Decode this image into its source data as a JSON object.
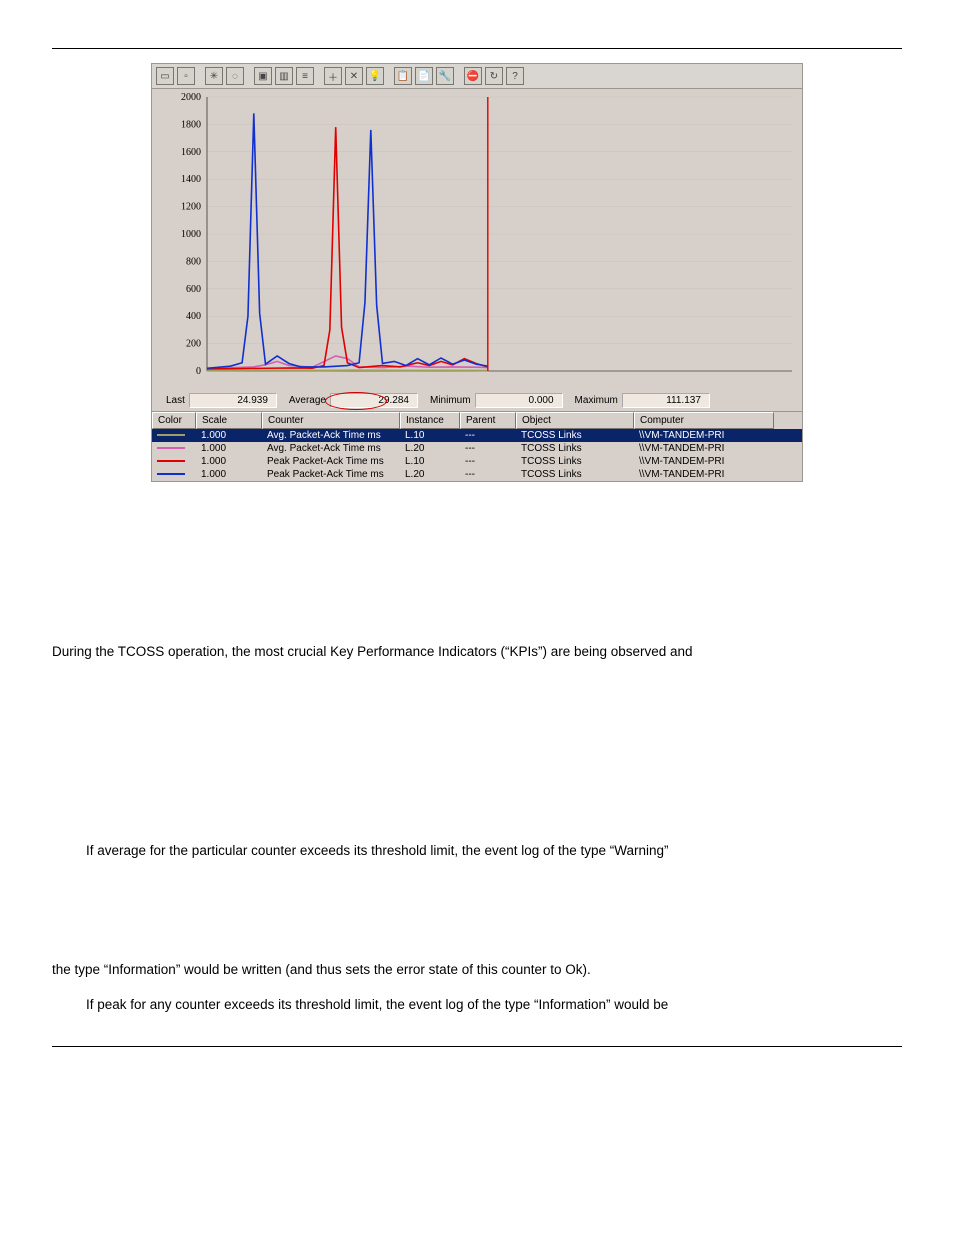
{
  "stats": {
    "last_label": "Last",
    "last": "24.939",
    "avg_label": "Average",
    "avg": "29.284",
    "min_label": "Minimum",
    "min": "0.000",
    "max_label": "Maximum",
    "max": "111.137"
  },
  "legend_head": {
    "color": "Color",
    "scale": "Scale",
    "counter": "Counter",
    "instance": "Instance",
    "parent": "Parent",
    "object": "Object",
    "computer": "Computer"
  },
  "legend_rows": [
    {
      "color": "#9fa060",
      "scale": "1.000",
      "counter": "Avg. Packet-Ack Time ms",
      "instance": "L.10",
      "parent": "---",
      "object": "TCOSS Links",
      "computer": "\\\\VM-TANDEM-PRI",
      "sel": true
    },
    {
      "color": "#d35fb2",
      "scale": "1.000",
      "counter": "Avg. Packet-Ack Time ms",
      "instance": "L.20",
      "parent": "---",
      "object": "TCOSS Links",
      "computer": "\\\\VM-TANDEM-PRI"
    },
    {
      "color": "#e00000",
      "scale": "1.000",
      "counter": "Peak Packet-Ack Time ms",
      "instance": "L.10",
      "parent": "---",
      "object": "TCOSS Links",
      "computer": "\\\\VM-TANDEM-PRI"
    },
    {
      "color": "#1030d0",
      "scale": "1.000",
      "counter": "Peak Packet-Ack Time ms",
      "instance": "L.20",
      "parent": "---",
      "object": "TCOSS Links",
      "computer": "\\\\VM-TANDEM-PRI"
    }
  ],
  "chart_data": {
    "type": "line",
    "ylim": [
      0,
      2000
    ],
    "yticks": [
      0,
      200,
      400,
      600,
      800,
      1000,
      1200,
      1400,
      1600,
      1800,
      2000
    ],
    "xrange": [
      0,
      100
    ],
    "cursor_x": 48,
    "series": [
      {
        "name": "Avg L.10",
        "color": "#9fa060",
        "points": [
          [
            0,
            3
          ],
          [
            5,
            4
          ],
          [
            10,
            5
          ],
          [
            15,
            4
          ],
          [
            20,
            4
          ],
          [
            25,
            6
          ],
          [
            30,
            5
          ],
          [
            35,
            4
          ],
          [
            40,
            5
          ],
          [
            45,
            4
          ],
          [
            48,
            3
          ]
        ]
      },
      {
        "name": "Avg L.20",
        "color": "#d35fb2",
        "points": [
          [
            0,
            20
          ],
          [
            5,
            25
          ],
          [
            8,
            30
          ],
          [
            10,
            45
          ],
          [
            12,
            70
          ],
          [
            14,
            40
          ],
          [
            18,
            28
          ],
          [
            22,
            110
          ],
          [
            24,
            90
          ],
          [
            26,
            30
          ],
          [
            30,
            25
          ],
          [
            34,
            35
          ],
          [
            38,
            28
          ],
          [
            42,
            30
          ],
          [
            46,
            28
          ],
          [
            48,
            25
          ]
        ]
      },
      {
        "name": "Peak L.10",
        "color": "#e00000",
        "points": [
          [
            0,
            15
          ],
          [
            6,
            18
          ],
          [
            10,
            20
          ],
          [
            15,
            22
          ],
          [
            18,
            20
          ],
          [
            20,
            40
          ],
          [
            21,
            300
          ],
          [
            22,
            1780
          ],
          [
            23,
            320
          ],
          [
            24,
            60
          ],
          [
            26,
            25
          ],
          [
            30,
            40
          ],
          [
            33,
            30
          ],
          [
            36,
            60
          ],
          [
            38,
            40
          ],
          [
            40,
            70
          ],
          [
            42,
            45
          ],
          [
            44,
            90
          ],
          [
            46,
            55
          ],
          [
            48,
            30
          ]
        ]
      },
      {
        "name": "Peak L.20",
        "color": "#1030d0",
        "points": [
          [
            0,
            20
          ],
          [
            4,
            35
          ],
          [
            6,
            60
          ],
          [
            7,
            400
          ],
          [
            8,
            1880
          ],
          [
            9,
            420
          ],
          [
            10,
            50
          ],
          [
            12,
            110
          ],
          [
            14,
            55
          ],
          [
            16,
            30
          ],
          [
            20,
            30
          ],
          [
            24,
            40
          ],
          [
            26,
            60
          ],
          [
            27,
            500
          ],
          [
            28,
            1760
          ],
          [
            29,
            480
          ],
          [
            30,
            55
          ],
          [
            32,
            70
          ],
          [
            34,
            40
          ],
          [
            36,
            90
          ],
          [
            38,
            45
          ],
          [
            40,
            95
          ],
          [
            42,
            50
          ],
          [
            44,
            80
          ],
          [
            46,
            50
          ],
          [
            48,
            35
          ]
        ]
      }
    ]
  },
  "text": {
    "p1": "During the TCOSS operation, the most crucial Key Performance Indicators (“KPIs”) are being observed and",
    "p2": "If average for the particular counter exceeds its threshold limit, the event log of the type “Warning”",
    "p3": "the type “Information” would be written (and thus sets the error state of this counter to Ok).",
    "p4": "If peak for any counter exceeds its threshold limit, the event log of the type “Information” would be"
  },
  "toolbar_icons": [
    "new-counter-set-icon",
    "clear-display-icon",
    "sep",
    "view-current-icon",
    "view-log-icon",
    "sep",
    "chart-view-icon",
    "histogram-view-icon",
    "report-view-icon",
    "sep",
    "add-icon",
    "delete-icon",
    "highlight-icon",
    "sep",
    "copy-icon",
    "paste-icon",
    "properties-icon",
    "sep",
    "freeze-icon",
    "update-icon",
    "help-icon"
  ]
}
